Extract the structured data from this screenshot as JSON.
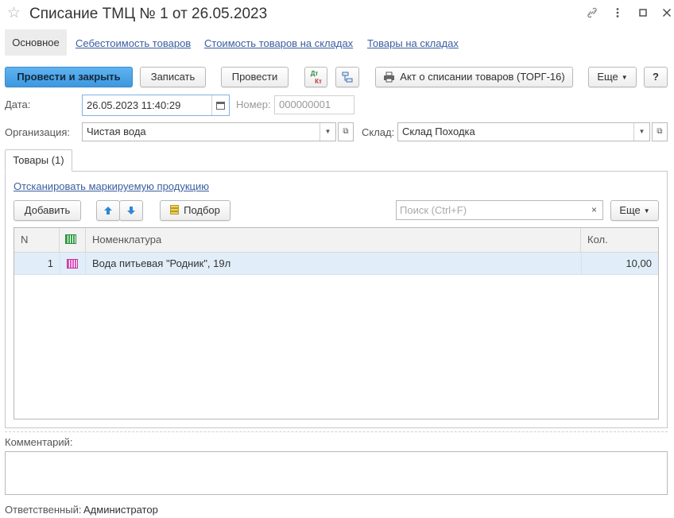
{
  "window": {
    "title": "Списание ТМЦ № 1 от 26.05.2023",
    "star_icon": "star-icon",
    "link_icon": "link-icon",
    "more_icon": "more-vertical-icon",
    "maximize_icon": "maximize-icon",
    "close_icon": "close-icon"
  },
  "tabs": {
    "active": "Основное",
    "links": [
      "Себестоимость товаров",
      "Стоимость товаров на складах",
      "Товары на складах"
    ]
  },
  "toolbar": {
    "post_close": "Провести и закрыть",
    "save": "Записать",
    "post": "Провести",
    "dt_kt_top": "Дт",
    "dt_kt_bottom": "Кт",
    "print_act": "Акт о списании товаров (ТОРГ-16)",
    "more": "Еще",
    "help": "?",
    "primary_color": "#3c98e0"
  },
  "form": {
    "date_label": "Дата:",
    "date_value": "26.05.2023 11:40:29",
    "number_label": "Номер:",
    "number_value": "000000001",
    "org_label": "Организация:",
    "org_value": "Чистая вода",
    "warehouse_label": "Склад:",
    "warehouse_value": "Склад Походка"
  },
  "goods": {
    "tab_label": "Товары (1)",
    "scan_link": "Отсканировать маркируемую продукцию",
    "add_button": "Добавить",
    "pick_button": "Подбор",
    "search_placeholder": "Поиск (Ctrl+F)",
    "clear": "×",
    "more": "Еще",
    "columns": {
      "n": "N",
      "nomenclature": "Номенклатура",
      "qty": "Кол."
    },
    "rows": [
      {
        "n": "1",
        "nomenclature": "Вода питьевая \"Родник\", 19л",
        "qty": "10,00"
      }
    ]
  },
  "comment": {
    "label": "Комментарий:"
  },
  "responsible": {
    "label": "Ответственный:",
    "value": "Администратор"
  }
}
